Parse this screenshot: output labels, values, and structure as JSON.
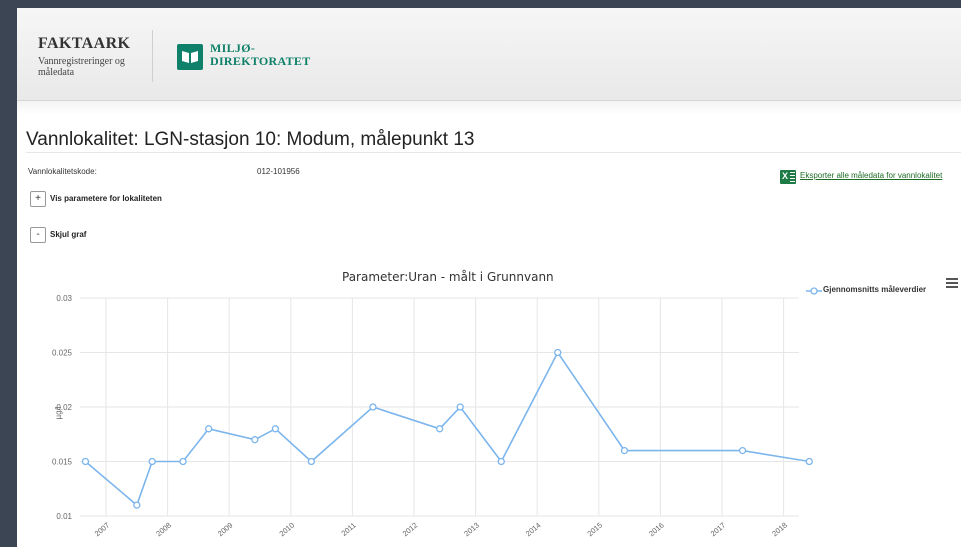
{
  "header": {
    "brand_title": "FAKTAARK",
    "brand_subtitle": "Vannregistreringer og måledata",
    "logo_line1": "MILJØ-",
    "logo_line2": "DIREKTORATET",
    "logo_color": "#0f8069"
  },
  "page": {
    "title": "Vannlokalitet: LGN-stasjon 10: Modum, målepunkt 13",
    "code_label": "Vannlokalitetskode:",
    "code_value": "012-101956",
    "export_label": "Eksporter alle måledata for vannlokalitet",
    "export_icon": "excel-icon",
    "show_params_symbol": "+",
    "show_params_label": "Vis parametere for lokaliteten",
    "hide_graph_symbol": "-",
    "hide_graph_label": "Skjul graf"
  },
  "chart_data": {
    "type": "line",
    "title": "Parameter:Uran - målt i Grunnvann",
    "ylabel": "µg/l",
    "xlabel": "",
    "ylim": [
      0.01,
      0.03
    ],
    "yticks": [
      "0.03",
      "0.025",
      "0.02",
      "0.015",
      "0.01"
    ],
    "xticks": [
      "2007",
      "2008",
      "2009",
      "2010",
      "2011",
      "2012",
      "2013",
      "2014",
      "2015",
      "2016",
      "2017",
      "2018"
    ],
    "grid": true,
    "legend_position": "top-right",
    "series": [
      {
        "name": "Gjennomsnitts måleverdier",
        "color": "#7cb5ec",
        "points": [
          {
            "x": "2006-09",
            "y": 0.015
          },
          {
            "x": "2007-07",
            "y": 0.011
          },
          {
            "x": "2007-10",
            "y": 0.015
          },
          {
            "x": "2008-04",
            "y": 0.015
          },
          {
            "x": "2008-09",
            "y": 0.018
          },
          {
            "x": "2009-06",
            "y": 0.017
          },
          {
            "x": "2009-10",
            "y": 0.018
          },
          {
            "x": "2010-05",
            "y": 0.015
          },
          {
            "x": "2011-05",
            "y": 0.02
          },
          {
            "x": "2012-06",
            "y": 0.018
          },
          {
            "x": "2012-10",
            "y": 0.02
          },
          {
            "x": "2013-06",
            "y": 0.015
          },
          {
            "x": "2014-05",
            "y": 0.025
          },
          {
            "x": "2015-06",
            "y": 0.016
          },
          {
            "x": "2017-05",
            "y": 0.016
          },
          {
            "x": "2018-06",
            "y": 0.015
          }
        ]
      }
    ]
  }
}
